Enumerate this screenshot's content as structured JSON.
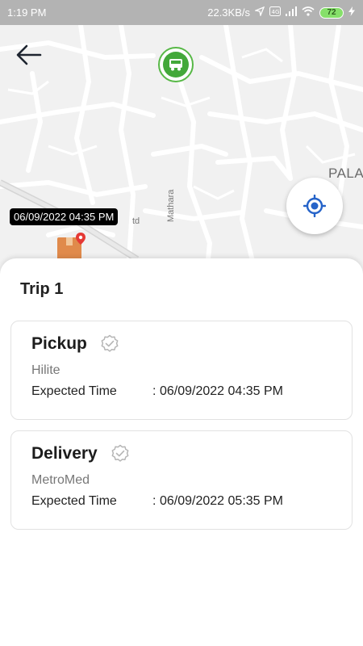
{
  "status_bar": {
    "time": "1:19 PM",
    "network_speed": "22.3KB/s",
    "battery": "72",
    "icons": [
      "location-icon",
      "volte-icon",
      "signal-icon",
      "wifi-icon",
      "battery-icon",
      "charging-icon"
    ]
  },
  "map": {
    "place_label": "PALA",
    "road_label_vertical": "Mathara",
    "road_label_partial": "td",
    "pickup_time_tag": "06/09/2022 04:35 PM",
    "colors": {
      "background": "#f1f1f1",
      "roads": "#ffffff",
      "marker_green": "#43a83a",
      "locate_blue": "#2563c9"
    }
  },
  "trip": {
    "title": "Trip 1",
    "stops": [
      {
        "type": "Pickup",
        "place": "Hilite",
        "time_label": "Expected Time",
        "separator": ":",
        "time_value": "06/09/2022 04:35 PM"
      },
      {
        "type": "Delivery",
        "place": "MetroMed",
        "time_label": "Expected Time",
        "separator": ":",
        "time_value": "06/09/2022 05:35 PM"
      }
    ]
  }
}
